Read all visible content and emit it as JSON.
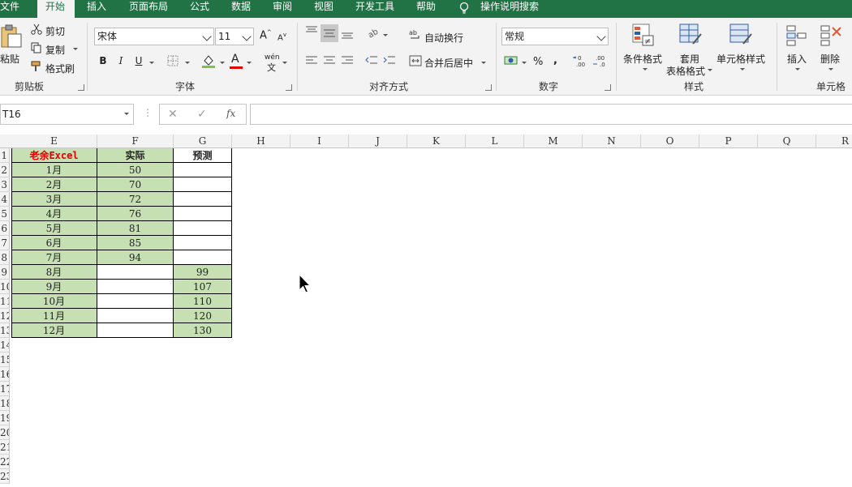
{
  "menu": {
    "tabs": [
      "文件",
      "开始",
      "插入",
      "页面布局",
      "公式",
      "数据",
      "审阅",
      "视图",
      "开发工具",
      "帮助"
    ],
    "active_tab": "开始",
    "tell_me": "操作说明搜索"
  },
  "ribbon": {
    "clipboard": {
      "paste": "粘贴",
      "cut": "剪切",
      "copy": "复制",
      "format_painter": "格式刷",
      "label": "剪贴板"
    },
    "font": {
      "name": "宋体",
      "size": "11",
      "bold": "B",
      "italic": "I",
      "underline": "U",
      "phonetic": "wén",
      "label": "字体"
    },
    "alignment": {
      "wrap_text": "自动换行",
      "merge_center": "合并后居中",
      "label": "对齐方式"
    },
    "number": {
      "format": "常规",
      "percent": "%",
      "comma": ",",
      "label": "数字"
    },
    "styles": {
      "conditional": "条件格式",
      "table_format_1": "套用",
      "table_format_2": "表格格式",
      "cell_styles": "单元格样式",
      "label": "样式"
    },
    "cells": {
      "insert": "插入",
      "delete": "删除",
      "label": "单元格"
    }
  },
  "formula_bar": {
    "name_box": "T16",
    "formula": ""
  },
  "columns": [
    "E",
    "F",
    "G",
    "H",
    "I",
    "J",
    "K",
    "L",
    "M",
    "N",
    "O",
    "P",
    "Q",
    "R"
  ],
  "rows": [
    "1",
    "2",
    "3",
    "4",
    "5",
    "6",
    "7",
    "8",
    "9",
    "10",
    "11",
    "12",
    "13",
    "14",
    "15",
    "16",
    "17",
    "18",
    "19",
    "20",
    "21",
    "22",
    "23"
  ],
  "table": {
    "headers": [
      "老余Excel",
      "实际",
      "预测"
    ],
    "data": [
      [
        "1月",
        "50",
        ""
      ],
      [
        "2月",
        "70",
        ""
      ],
      [
        "3月",
        "72",
        ""
      ],
      [
        "4月",
        "76",
        ""
      ],
      [
        "5月",
        "81",
        ""
      ],
      [
        "6月",
        "85",
        ""
      ],
      [
        "7月",
        "94",
        ""
      ],
      [
        "8月",
        "",
        "99"
      ],
      [
        "9月",
        "",
        "107"
      ],
      [
        "10月",
        "",
        "110"
      ],
      [
        "11月",
        "",
        "120"
      ],
      [
        "12月",
        "",
        "130"
      ]
    ]
  },
  "colors": {
    "accent": "#217346",
    "cell_fill": "#c6e0b4",
    "brand_text": "#e00000"
  }
}
